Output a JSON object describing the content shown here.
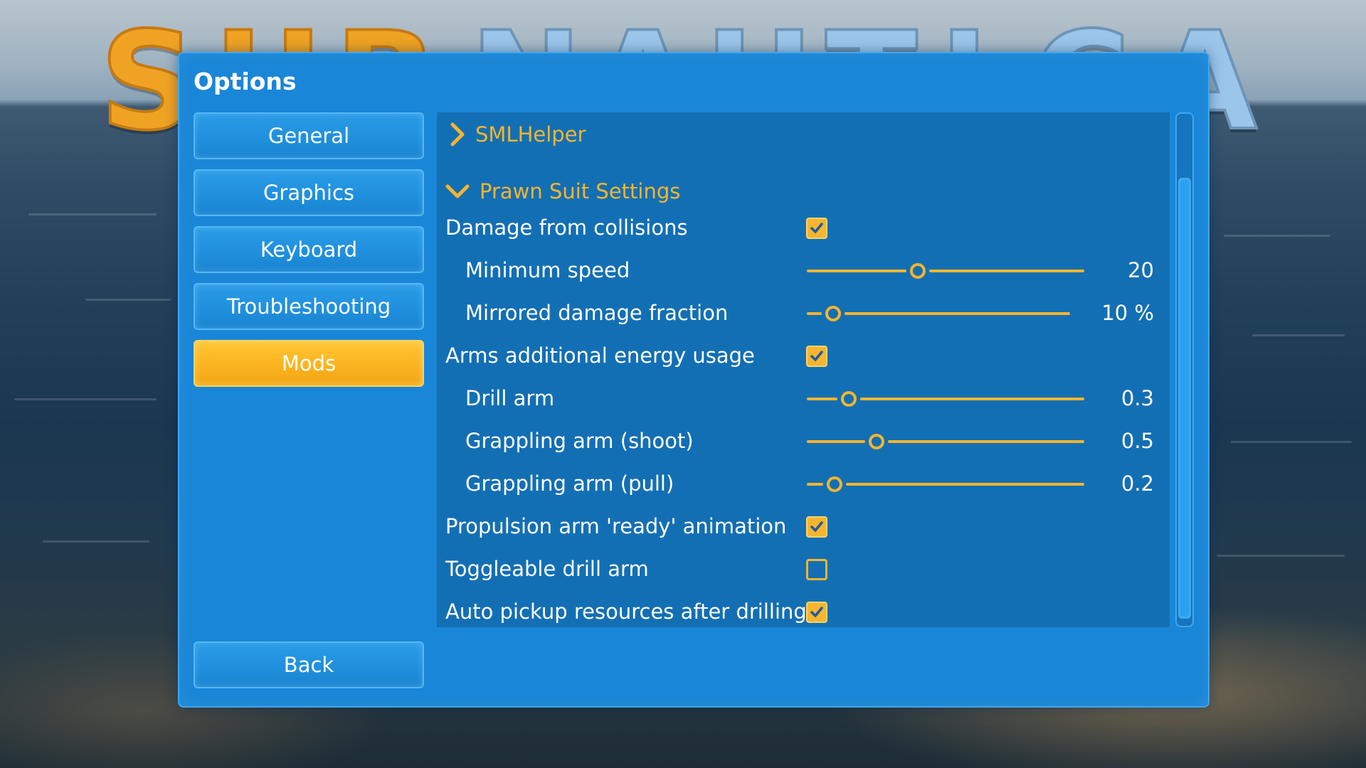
{
  "background": {
    "logo_letters_orange": [
      "S",
      "U",
      "B"
    ],
    "logo_letters_blue": [
      "N",
      "A",
      "U",
      "T",
      "I",
      "C",
      "A"
    ]
  },
  "panel": {
    "title": "Options"
  },
  "nav": {
    "general": "General",
    "graphics": "Graphics",
    "keyboard": "Keyboard",
    "troubleshooting": "Troubleshooting",
    "mods": "Mods",
    "back": "Back",
    "active": "Mods"
  },
  "content": {
    "smlhelper": {
      "label": "SMLHelper",
      "expanded": false
    },
    "prawn": {
      "label": "Prawn Suit Settings",
      "expanded": true,
      "rows": [
        {
          "label": "Damage from collisions",
          "type": "checkbox",
          "checked": true
        },
        {
          "label": "Minimum speed",
          "type": "slider",
          "value_text": "20",
          "fraction": 0.4
        },
        {
          "label": "Mirrored damage fraction",
          "type": "slider",
          "value_text": "10 %",
          "fraction": 0.1
        },
        {
          "label": "Arms additional energy usage",
          "type": "checkbox",
          "checked": true
        },
        {
          "label": "Drill arm",
          "type": "slider",
          "value_text": "0.3",
          "fraction": 0.15
        },
        {
          "label": "Grappling arm (shoot)",
          "type": "slider",
          "value_text": "0.5",
          "fraction": 0.25
        },
        {
          "label": "Grappling arm (pull)",
          "type": "slider",
          "value_text": "0.2",
          "fraction": 0.1
        },
        {
          "label": "Propulsion arm 'ready' animation",
          "type": "checkbox",
          "checked": true
        },
        {
          "label": "Toggleable drill arm",
          "type": "checkbox",
          "checked": false
        },
        {
          "label": "Auto pickup resources after drilling",
          "type": "checkbox",
          "checked": true
        }
      ]
    }
  },
  "colors": {
    "panel": "#1a86d7",
    "content": "#136fb4",
    "accent": "#f6b52e",
    "text": "#ffffff"
  },
  "icons": {
    "collapsed": "chevron-right-icon",
    "expanded": "chevron-down-icon",
    "checkmark": "checkmark-icon"
  }
}
